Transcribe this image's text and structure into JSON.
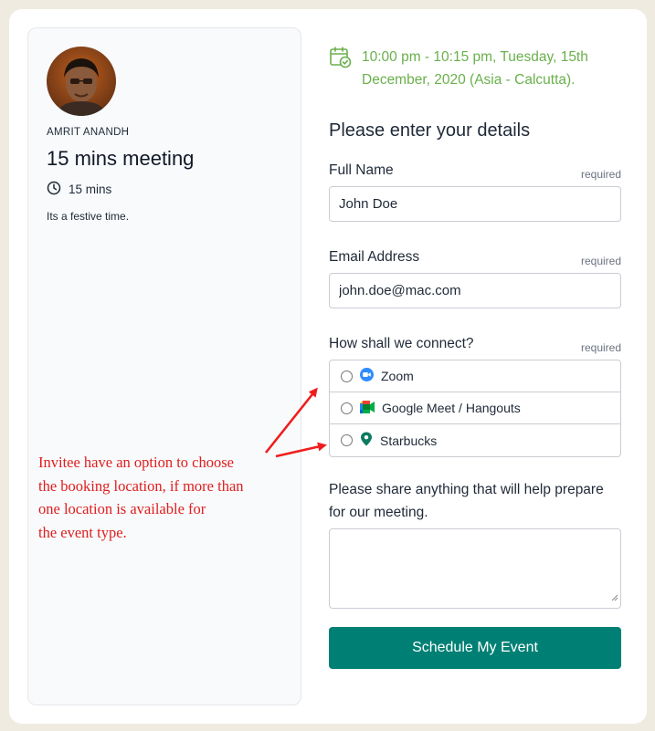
{
  "host": {
    "name": "AMRIT ANANDH",
    "avatar_icon": "profile-photo"
  },
  "event": {
    "title": "15 mins meeting",
    "duration": "15 mins",
    "description": "Its a festive time."
  },
  "schedule": {
    "when": "10:00 pm - 10:15 pm, Tuesday, 15th December, 2020 (Asia - Calcutta).",
    "accent_color": "#6ab04c"
  },
  "form": {
    "title": "Please enter your details",
    "full_name": {
      "label": "Full Name",
      "required": "required",
      "value": "John Doe"
    },
    "email": {
      "label": "Email Address",
      "required": "required",
      "value": "john.doe@mac.com"
    },
    "connect": {
      "label": "How shall we connect?",
      "required": "required",
      "options": [
        {
          "label": "Zoom",
          "icon": "zoom-icon"
        },
        {
          "label": "Google Meet / Hangouts",
          "icon": "google-meet-icon"
        },
        {
          "label": "Starbucks",
          "icon": "map-pin-icon"
        }
      ]
    },
    "notes": {
      "label": "Please share anything that will help prepare for our meeting.",
      "value": ""
    },
    "submit_label": "Schedule My Event",
    "button_color": "#008075"
  },
  "annotation": {
    "lines": [
      "Invitee have an option to choose",
      "the booking location, if more than",
      "one location is available for",
      "the event type."
    ],
    "color": "#e11d1d"
  }
}
